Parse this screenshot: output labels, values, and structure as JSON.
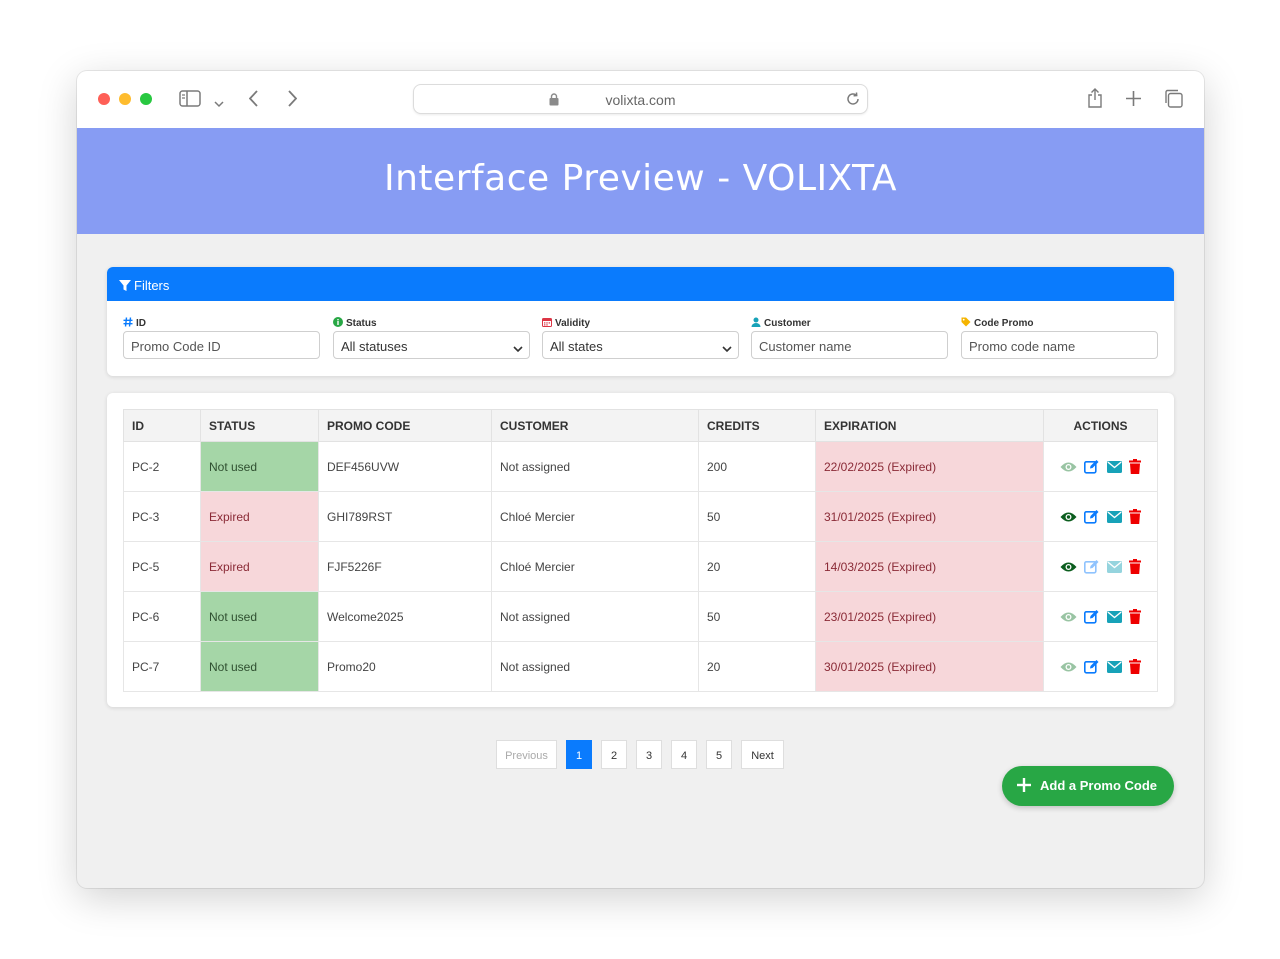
{
  "browser": {
    "url": "volixta.com"
  },
  "banner": {
    "title": "Interface Preview - VOLIXTA"
  },
  "filters": {
    "header": "Filters",
    "fields": [
      {
        "label": "ID",
        "placeholder": "Promo Code ID",
        "icon": "hash-icon"
      },
      {
        "label": "Status",
        "value": "All statuses",
        "icon": "info-circle-icon"
      },
      {
        "label": "Validity",
        "value": "All states",
        "icon": "calendar-icon"
      },
      {
        "label": "Customer",
        "placeholder": "Customer name",
        "icon": "user-icon"
      },
      {
        "label": "Code Promo",
        "placeholder": "Promo code name",
        "icon": "tag-icon"
      }
    ]
  },
  "table": {
    "headers": [
      "ID",
      "STATUS",
      "PROMO CODE",
      "CUSTOMER",
      "CREDITS",
      "EXPIRATION",
      "ACTIONS"
    ],
    "rows": [
      {
        "id": "PC-2",
        "status": "Not used",
        "code": "DEF456UVW",
        "customer": "Not assigned",
        "credits": "200",
        "expiration": "22/02/2025 (Expired)"
      },
      {
        "id": "PC-3",
        "status": "Expired",
        "code": "GHI789RST",
        "customer": "Chloé Mercier",
        "credits": "50",
        "expiration": "31/01/2025 (Expired)"
      },
      {
        "id": "PC-5",
        "status": "Expired",
        "code": "FJF5226F",
        "customer": "Chloé Mercier",
        "credits": "20",
        "expiration": "14/03/2025 (Expired)"
      },
      {
        "id": "PC-6",
        "status": "Not used",
        "code": "Welcome2025",
        "customer": "Not assigned",
        "credits": "50",
        "expiration": "23/01/2025 (Expired)"
      },
      {
        "id": "PC-7",
        "status": "Not used",
        "code": "Promo20",
        "customer": "Not assigned",
        "credits": "20",
        "expiration": "30/01/2025 (Expired)"
      }
    ]
  },
  "pagination": {
    "previous": "Previous",
    "pages": [
      "1",
      "2",
      "3",
      "4",
      "5"
    ],
    "next": "Next",
    "current": "1"
  },
  "add_button": {
    "label": "Add a Promo Code"
  },
  "colors": {
    "banner": "#879cf3",
    "primary": "#0a7bfd",
    "success": "#28a745",
    "status_green": "#a5d6a7",
    "status_red": "#f7d7da"
  }
}
